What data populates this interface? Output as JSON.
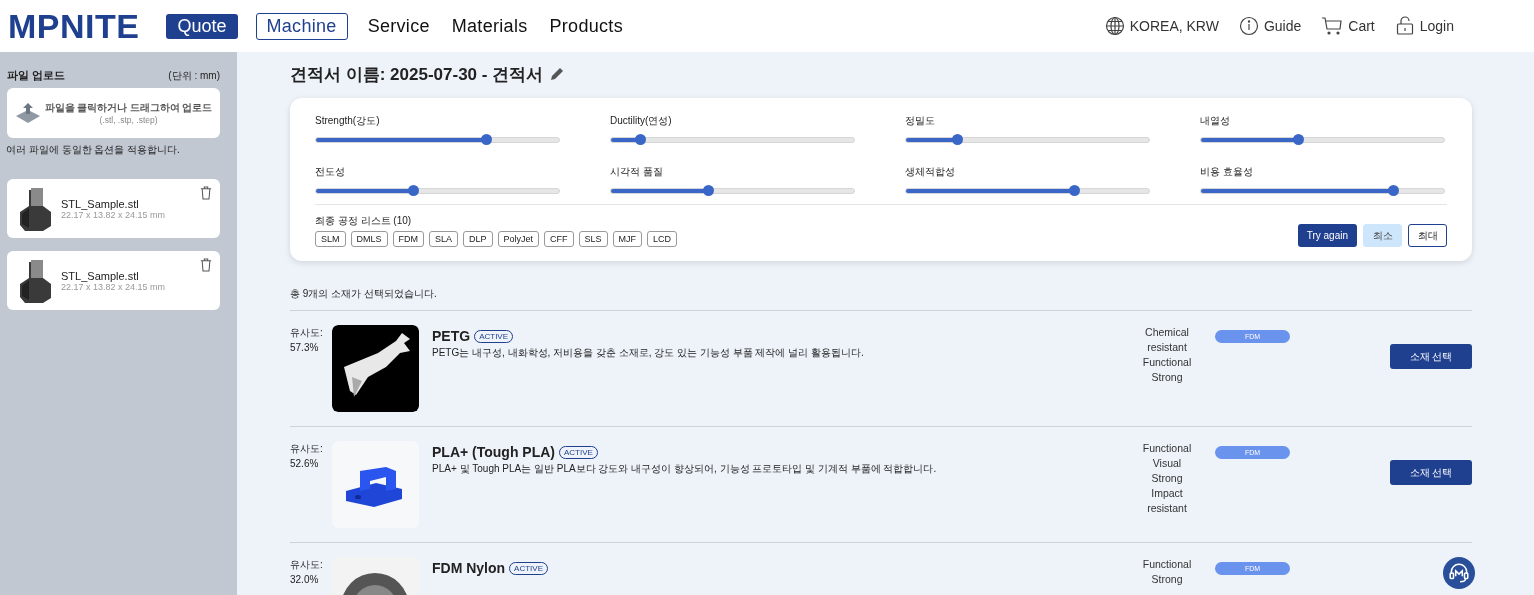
{
  "header": {
    "logo": "MPNITE",
    "quote_badge": "Quote",
    "nav": [
      {
        "label": "Machine",
        "selected": true
      },
      {
        "label": "Service",
        "selected": false
      },
      {
        "label": "Materials",
        "selected": false
      },
      {
        "label": "Products",
        "selected": false
      }
    ],
    "region": "KOREA, KRW",
    "guide": "Guide",
    "cart": "Cart",
    "login": "Login"
  },
  "sidebar": {
    "title": "파일 업로드",
    "unit": "(단위 : mm)",
    "upload": {
      "label": "파일을 클릭하거나 드래그하여 업로드",
      "formats": "(.stl, .stp, .step)"
    },
    "note": "여러 파일에 동일한 옵션을 적용합니다.",
    "files": [
      {
        "name": "STL_Sample.stl",
        "size": "22.17 x 13.82 x 24.15 mm"
      },
      {
        "name": "STL_Sample.stl",
        "size": "22.17 x 13.82 x 24.15 mm"
      }
    ]
  },
  "quote": {
    "title": "견적서 이름: 2025-07-30 - 견적서",
    "sliders": [
      {
        "label": "Strength(강도)",
        "level": 0.7
      },
      {
        "label": "Ductility(연성)",
        "level": 0.12
      },
      {
        "label": "정밀도",
        "level": 0.21
      },
      {
        "label": "내열성",
        "level": 0.4
      },
      {
        "label": "전도성",
        "level": 0.4
      },
      {
        "label": "시각적 품질",
        "level": 0.4
      },
      {
        "label": "생체적합성",
        "level": 0.69
      },
      {
        "label": "비용 효율성",
        "level": 0.79
      }
    ],
    "process_title": "최종 공정 리스트 (10)",
    "processes": [
      "SLM",
      "DMLS",
      "FDM",
      "SLA",
      "DLP",
      "PolyJet",
      "CFF",
      "SLS",
      "MJF",
      "LCD"
    ],
    "try_again": "Try again",
    "modes": [
      {
        "label": "최소",
        "selected": true
      },
      {
        "label": "최대",
        "selected": false
      }
    ]
  },
  "summary": "총 9개의 소재가 선택되었습니다.",
  "materials": [
    {
      "similarity_label": "유사도:",
      "similarity": "57.3%",
      "kind": "picture",
      "name": "PETG",
      "badge": "ACTIVE",
      "description": "PETG는 내구성, 내화학성, 저비용을 갖춘 소재로, 강도 있는 기능성 부품 제작에 널리 활용됩니다.",
      "properties": [
        "Chemical",
        "resistant",
        "Functional",
        "Strong"
      ],
      "process": "FDM",
      "button": "소재 선택"
    },
    {
      "similarity_label": "유사도:",
      "similarity": "52.6%",
      "kind": "picture",
      "name": "PLA+ (Tough PLA)",
      "badge": "ACTIVE",
      "description": "PLA+ 및 Tough PLA는 일반 PLA보다 강도와 내구성이 향상되어, 기능성 프로토타입 및 기계적 부품에 적합합니다.",
      "properties": [
        "Functional",
        "Visual",
        "Strong",
        "Impact",
        "resistant"
      ],
      "process": "FDM",
      "button": "소재 선택"
    },
    {
      "similarity_label": "유사도:",
      "similarity": "32.0%",
      "kind": "picture",
      "name": "FDM Nylon",
      "badge": "ACTIVE",
      "properties": [
        "Functional",
        "Strong"
      ],
      "process": "FDM"
    }
  ]
}
